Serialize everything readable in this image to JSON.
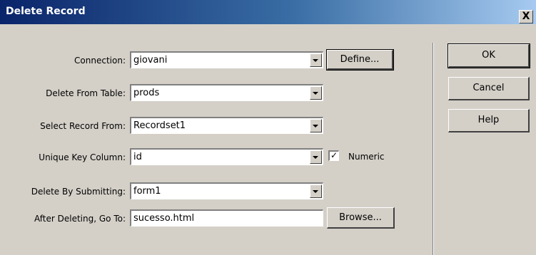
{
  "window": {
    "title": "Delete Record",
    "close_glyph": "X"
  },
  "form": {
    "connection_label": "Connection:",
    "connection_value": "giovani",
    "define_button": "Define...",
    "table_label": "Delete From Table:",
    "table_value": "prods",
    "select_record_label": "Select Record From:",
    "select_record_value": "Recordset1",
    "unique_key_label": "Unique Key Column:",
    "unique_key_value": "id",
    "numeric_label": "Numeric",
    "numeric_checked": true,
    "submit_label": "Delete By Submitting:",
    "submit_value": "form1",
    "after_label": "After Deleting, Go To:",
    "after_value": "sucesso.html",
    "browse_button": "Browse..."
  },
  "buttons": {
    "ok": "OK",
    "cancel": "Cancel",
    "help": "Help"
  },
  "icons": {
    "dropdown": "chevron-down-icon",
    "check": "check-icon",
    "close": "close-icon"
  }
}
